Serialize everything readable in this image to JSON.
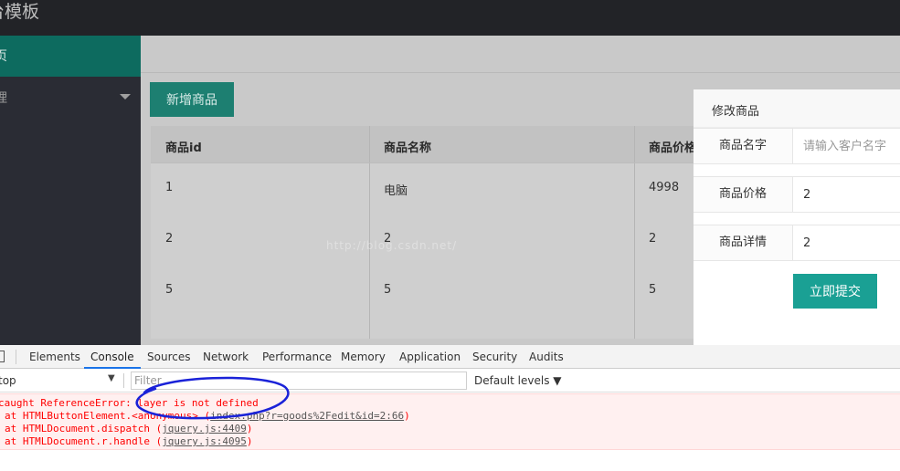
{
  "app": {
    "title": "台模板",
    "sidebar": {
      "active_item": "页",
      "item2": "理"
    },
    "add_button": "新增商品",
    "table": {
      "headers": [
        "商品id",
        "商品名称",
        "商品价格"
      ],
      "rows": [
        [
          "1",
          "电脑",
          "4998"
        ],
        [
          "2",
          "2",
          "2"
        ],
        [
          "5",
          "5",
          "5"
        ]
      ]
    },
    "watermark": "http://blog.csdn.net/"
  },
  "modal": {
    "title": "修改商品",
    "fields": [
      {
        "label": "商品名字",
        "value": "",
        "placeholder": "请输入客户名字"
      },
      {
        "label": "商品价格",
        "value": "2",
        "placeholder": ""
      },
      {
        "label": "商品详情",
        "value": "2",
        "placeholder": ""
      }
    ],
    "submit": "立即提交"
  },
  "devtools": {
    "tabs": [
      "Elements",
      "Console",
      "Sources",
      "Network",
      "Performance",
      "Memory",
      "Application",
      "Security",
      "Audits"
    ],
    "active_tab": "Console",
    "context": "top",
    "filter_placeholder": "Filter",
    "levels": "Default levels ▼",
    "error": {
      "message": "caught ReferenceError: layer is not defined",
      "stack": [
        {
          "text": "at HTMLButtonElement.<anonymous> (",
          "link": "index.php?r=goods%2Fedit&id=2:66",
          "end": ")"
        },
        {
          "text": "at HTMLDocument.dispatch (",
          "link": "jquery.js:4409",
          "end": ")"
        },
        {
          "text": "at HTMLDocument.r.handle (",
          "link": "jquery.js:4095",
          "end": ")"
        }
      ]
    },
    "annotation_color": "#1a22d8"
  }
}
